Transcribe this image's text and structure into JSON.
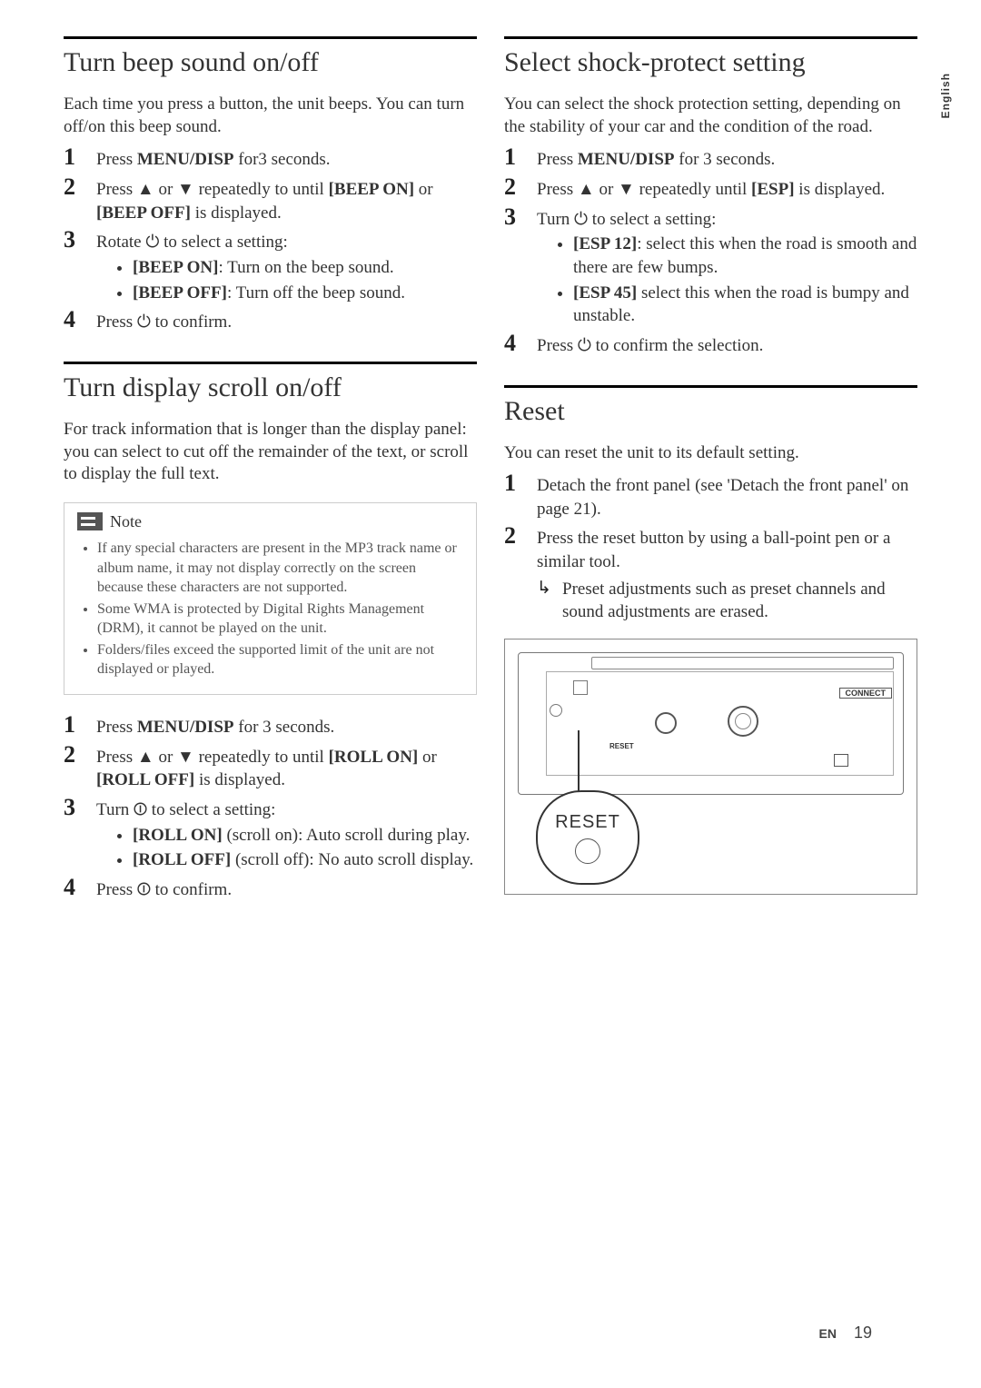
{
  "lang_tab": "English",
  "footer": {
    "lang": "EN",
    "page": "19"
  },
  "left": {
    "sec1": {
      "heading": "Turn beep sound on/off",
      "intro": "Each time you press a button, the unit beeps. You can turn off/on this beep sound.",
      "s1_a": "Press ",
      "s1_b": "MENU/DISP",
      "s1_c": " for3 seconds.",
      "s2_a": "Press ",
      "s2_b": " or ",
      "s2_c": " repeatedly to until ",
      "s2_d": "[BEEP ON]",
      "s2_e": " or ",
      "s2_f": "[BEEP OFF]",
      "s2_g": " is displayed.",
      "s3_a": "Rotate ",
      "s3_b": " to select a setting:",
      "s3_li1_a": "[BEEP ON]",
      "s3_li1_b": ": Turn on the beep sound.",
      "s3_li2_a": "[BEEP OFF]",
      "s3_li2_b": ": Turn off the beep sound.",
      "s4_a": "Press ",
      "s4_b": " to confirm."
    },
    "sec2": {
      "heading": "Turn display scroll on/off",
      "intro": "For track information that is longer than the display panel: you can select to cut off the remainder of the text, or scroll to display the full text.",
      "note_title": "Note",
      "note1": "If any special characters are present in the MP3 track name or album name, it may not display correctly on the screen because these characters are not supported.",
      "note2": "Some WMA is protected by Digital Rights Management (DRM), it cannot be played on the unit.",
      "note3": "Folders/files exceed the supported limit of the unit are not displayed or played.",
      "s1_a": "Press ",
      "s1_b": "MENU/DISP",
      "s1_c": " for 3 seconds.",
      "s2_a": "Press ",
      "s2_b": " or ",
      "s2_c": " repeatedly to until ",
      "s2_d": "[ROLL ON]",
      "s2_e": " or ",
      "s2_f": "[ROLL OFF]",
      "s2_g": " is displayed.",
      "s3_a": "Turn ",
      "s3_b": " to select a setting:",
      "s3_li1_a": "[ROLL ON]",
      "s3_li1_b": " (scroll on): Auto scroll during play.",
      "s3_li2_a": "[ROLL OFF]",
      "s3_li2_b": " (scroll off): No auto scroll display.",
      "s4_a": "Press ",
      "s4_b": " to confirm."
    }
  },
  "right": {
    "sec1": {
      "heading": "Select shock-protect setting",
      "intro": "You can select the shock protection setting, depending on the stability of your car and the condition of the road.",
      "s1_a": "Press ",
      "s1_b": "MENU/DISP",
      "s1_c": " for 3 seconds.",
      "s2_a": "Press ",
      "s2_b": " or ",
      "s2_c": " repeatedly until ",
      "s2_d": "[ESP]",
      "s2_e": " is displayed.",
      "s3_a": "Turn ",
      "s3_b": " to select a setting:",
      "s3_li1_a": "[ESP 12]",
      "s3_li1_b": ": select this when the road is smooth and there are few bumps.",
      "s3_li2_a": "[ESP 45]",
      "s3_li2_b": " select this when the road is bumpy and unstable.",
      "s4_a": "Press ",
      "s4_b": " to confirm the selection."
    },
    "sec2": {
      "heading": "Reset",
      "intro": "You can reset the unit to its default setting.",
      "s1": "Detach the front panel (see 'Detach the front panel' on page 21).",
      "s2": "Press the reset button by using a ball-point pen or a similar tool.",
      "result": "Preset adjustments such as preset channels and sound adjustments are erased.",
      "diagram_connect": "CONNECT",
      "diagram_reset_small": "RESET",
      "diagram_reset_callout": "RESET"
    }
  },
  "symbols": {
    "up": "▲",
    "down": "▼",
    "power": "⏻",
    "power2": "⏼",
    "arrow_result": "↳"
  }
}
